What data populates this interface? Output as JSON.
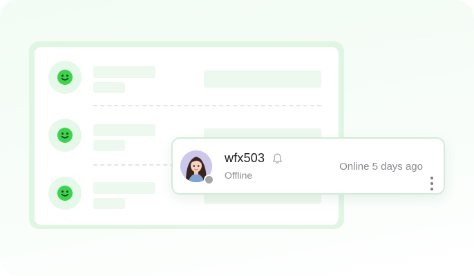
{
  "contact": {
    "username": "wfx503",
    "status": "Offline",
    "last_seen": "Online 5 days ago",
    "presence": "offline"
  },
  "list": {
    "row_count": 3,
    "icon": "smiley-face-icon",
    "placeholder": true
  },
  "icons": {
    "notification": "bell-icon",
    "menu": "more-vertical-icon",
    "avatar": "user-avatar"
  },
  "colors": {
    "accent_green": "#3ed34e",
    "presence_offline": "#a6a6a6",
    "card_border": "#d3ebd7"
  }
}
